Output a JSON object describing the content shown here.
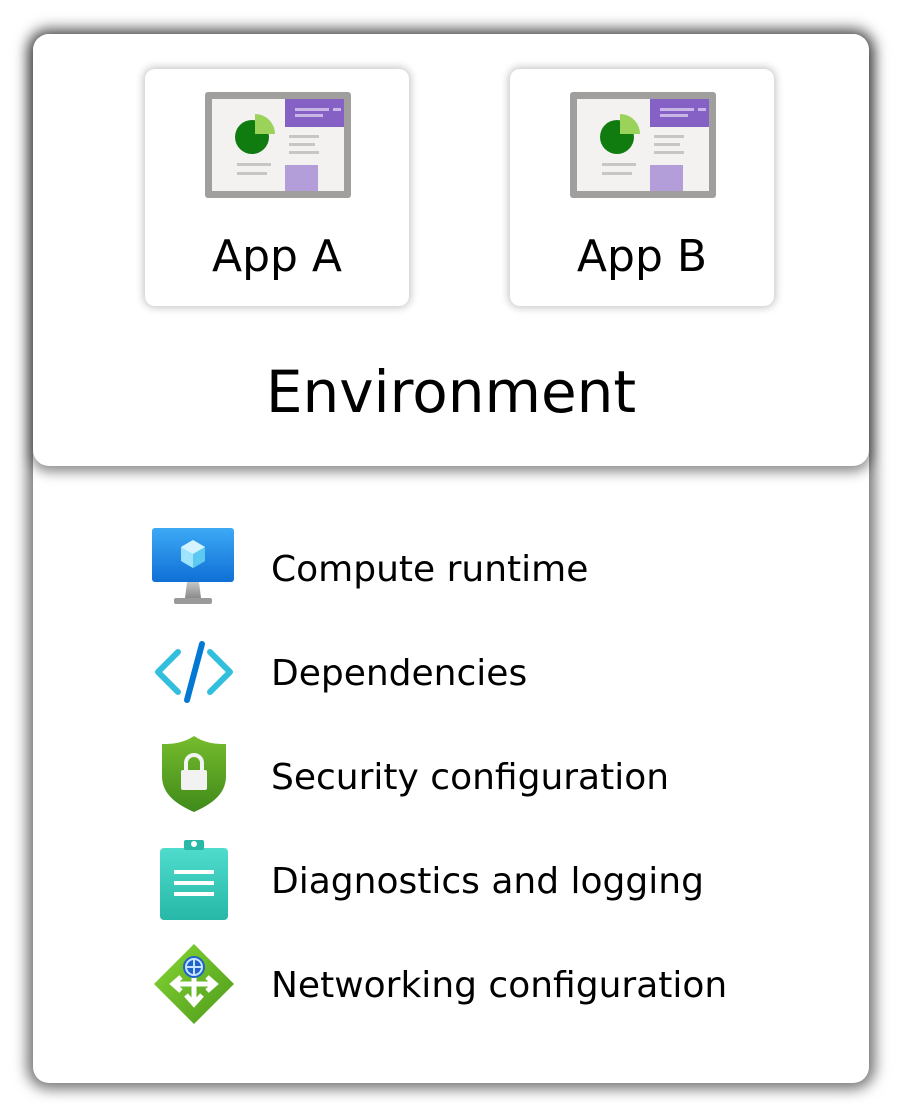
{
  "environment": {
    "title": "Environment",
    "apps": [
      {
        "label": "App A",
        "icon": "app-window-icon"
      },
      {
        "label": "App B",
        "icon": "app-window-icon"
      }
    ]
  },
  "features": [
    {
      "label": "Compute runtime",
      "icon": "virtual-machine-icon"
    },
    {
      "label": "Dependencies",
      "icon": "code-icon"
    },
    {
      "label": "Security configuration",
      "icon": "shield-lock-icon"
    },
    {
      "label": "Diagnostics and logging",
      "icon": "clipboard-icon"
    },
    {
      "label": "Networking configuration",
      "icon": "network-arrows-icon"
    }
  ],
  "colors": {
    "app_frame": "#a19f9d",
    "app_header": "#8661c5",
    "chart_dark": "#107c10",
    "chart_light": "#9bd35a",
    "monitor_blue": "#1e88e5",
    "code_blue": "#32bedd",
    "shield_green": "#5ea829",
    "clipboard_teal": "#3bd2c3",
    "network_green": "#6fbb2c"
  }
}
